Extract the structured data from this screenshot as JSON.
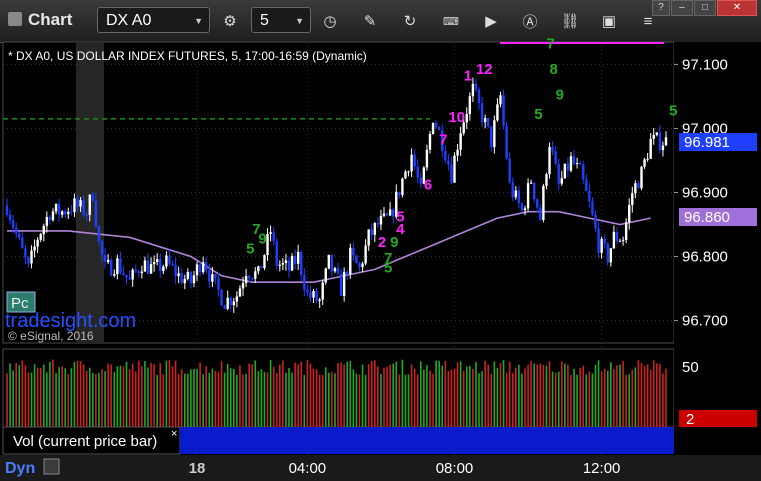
{
  "toolbar": {
    "app_title": "Chart",
    "symbol": "DX A0",
    "interval": "5"
  },
  "chart_header": "* DX A0, US DOLLAR INDEX FUTURES, 5, 17:00-16:59 (Dynamic)",
  "watermark": "tradesight.com",
  "copyright": "© eSignal, 2016",
  "badge": "Pc",
  "lower_panel": {
    "label": "Vol (current price bar)",
    "close_glyph": "×",
    "axis_label": "50",
    "value_tag": "2"
  },
  "bottom_bar": {
    "label": "Dyn"
  },
  "colors": {
    "up_candle": "#ffffff",
    "down_candle": "#1f3fff",
    "ma_line": "#b084d8",
    "last_price_tag": "#1f3fff",
    "ma_tag": "#a070d8",
    "count_magenta": "#ff22ff",
    "count_green": "#22aa22",
    "volume_red": "#cc2222",
    "volume_green": "#22aa22",
    "value_tag": "#cc0000"
  },
  "chart_data": {
    "type": "candlestick",
    "title": "* DX A0, US DOLLAR INDEX FUTURES, 5, 17:00-16:59 (Dynamic)",
    "y_ticks": [
      97.1,
      97.0,
      96.9,
      96.8,
      96.7
    ],
    "y_tick_labels": [
      "97.100",
      "97.000",
      "96.900",
      "96.800",
      "96.700"
    ],
    "ylim": [
      96.665,
      97.135
    ],
    "x_tick_labels": [
      {
        "label": "18",
        "bar": 62
      },
      {
        "label": "04:00",
        "bar": 98
      },
      {
        "label": "08:00",
        "bar": 146
      },
      {
        "label": "12:00",
        "bar": 194
      }
    ],
    "last_price": "96.981",
    "ma_value": "96.860",
    "dashed_level": 97.015,
    "anchors": [
      [
        0,
        96.88
      ],
      [
        4,
        96.82
      ],
      [
        7,
        96.78
      ],
      [
        10,
        96.83
      ],
      [
        14,
        96.87
      ],
      [
        18,
        96.87
      ],
      [
        22,
        96.88
      ],
      [
        26,
        96.87
      ],
      [
        28,
        96.9
      ],
      [
        30,
        96.82
      ],
      [
        32,
        96.78
      ],
      [
        36,
        96.79
      ],
      [
        40,
        96.76
      ],
      [
        44,
        96.79
      ],
      [
        48,
        96.78
      ],
      [
        52,
        96.79
      ],
      [
        56,
        96.77
      ],
      [
        60,
        96.76
      ],
      [
        64,
        96.8
      ],
      [
        67,
        96.76
      ],
      [
        71,
        96.73
      ],
      [
        75,
        96.74
      ],
      [
        78,
        96.78
      ],
      [
        82,
        96.77
      ],
      [
        86,
        96.84
      ],
      [
        88,
        96.79
      ],
      [
        92,
        96.78
      ],
      [
        95,
        96.8
      ],
      [
        98,
        96.74
      ],
      [
        102,
        96.73
      ],
      [
        105,
        96.79
      ],
      [
        109,
        96.75
      ],
      [
        112,
        96.8
      ],
      [
        115,
        96.78
      ],
      [
        118,
        96.83
      ],
      [
        121,
        96.85
      ],
      [
        125,
        96.86
      ],
      [
        129,
        96.92
      ],
      [
        132,
        96.96
      ],
      [
        135,
        96.9
      ],
      [
        139,
        97.02
      ],
      [
        142,
        96.98
      ],
      [
        145,
        96.93
      ],
      [
        148,
        97.0
      ],
      [
        152,
        97.06
      ],
      [
        155,
        97.02
      ],
      [
        158,
        96.98
      ],
      [
        161,
        97.05
      ],
      [
        164,
        96.91
      ],
      [
        168,
        96.87
      ],
      [
        171,
        96.92
      ],
      [
        174,
        96.86
      ],
      [
        177,
        96.98
      ],
      [
        180,
        96.91
      ],
      [
        184,
        96.95
      ],
      [
        187,
        96.93
      ],
      [
        190,
        96.88
      ],
      [
        193,
        96.82
      ],
      [
        196,
        96.8
      ],
      [
        198,
        96.83
      ],
      [
        201,
        96.83
      ],
      [
        204,
        96.9
      ],
      [
        207,
        96.93
      ],
      [
        210,
        96.98
      ]
    ],
    "moving_average": [
      [
        0,
        96.84
      ],
      [
        20,
        96.84
      ],
      [
        40,
        96.83
      ],
      [
        60,
        96.8
      ],
      [
        70,
        96.77
      ],
      [
        80,
        96.76
      ],
      [
        90,
        96.76
      ],
      [
        100,
        96.76
      ],
      [
        110,
        96.77
      ],
      [
        120,
        96.78
      ],
      [
        130,
        96.8
      ],
      [
        140,
        96.82
      ],
      [
        150,
        96.84
      ],
      [
        160,
        96.86
      ],
      [
        170,
        96.87
      ],
      [
        180,
        96.87
      ],
      [
        190,
        96.86
      ],
      [
        200,
        96.85
      ],
      [
        210,
        96.86
      ]
    ],
    "count_labels": [
      {
        "text": "7",
        "bar": 80,
        "y": 96.835,
        "color": "green"
      },
      {
        "text": "9",
        "bar": 82,
        "y": 96.82,
        "color": "green"
      },
      {
        "text": "5",
        "bar": 78,
        "y": 96.805,
        "color": "green"
      },
      {
        "text": "9",
        "bar": 125,
        "y": 96.815,
        "color": "green"
      },
      {
        "text": "7",
        "bar": 123,
        "y": 96.79,
        "color": "green"
      },
      {
        "text": "5",
        "bar": 123,
        "y": 96.775,
        "color": "green"
      },
      {
        "text": "2",
        "bar": 121,
        "y": 96.815,
        "color": "magenta"
      },
      {
        "text": "4",
        "bar": 127,
        "y": 96.835,
        "color": "magenta"
      },
      {
        "text": "5",
        "bar": 127,
        "y": 96.855,
        "color": "magenta"
      },
      {
        "text": "6",
        "bar": 136,
        "y": 96.905,
        "color": "magenta"
      },
      {
        "text": "7",
        "bar": 141,
        "y": 96.975,
        "color": "magenta"
      },
      {
        "text": "10",
        "bar": 144,
        "y": 97.01,
        "color": "magenta"
      },
      {
        "text": "1",
        "bar": 149,
        "y": 97.075,
        "color": "magenta"
      },
      {
        "text": "12",
        "bar": 153,
        "y": 97.085,
        "color": "magenta"
      },
      {
        "text": "7",
        "bar": 176,
        "y": 97.125,
        "color": "green"
      },
      {
        "text": "8",
        "bar": 177,
        "y": 97.085,
        "color": "green"
      },
      {
        "text": "9",
        "bar": 179,
        "y": 97.045,
        "color": "green"
      },
      {
        "text": "5",
        "bar": 172,
        "y": 97.015,
        "color": "green"
      },
      {
        "text": "5",
        "bar": 216,
        "y": 97.02,
        "color": "green"
      }
    ],
    "volume": {
      "bars": 216,
      "ylim": [
        0,
        60
      ]
    }
  }
}
